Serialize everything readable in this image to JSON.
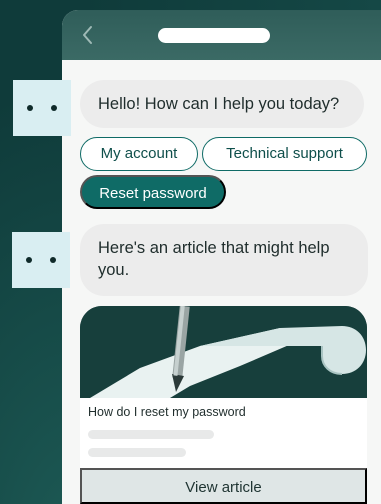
{
  "header": {
    "back_icon": "chevron-left-icon"
  },
  "messages": {
    "greeting": "Hello! How can I help you today?",
    "article_intro": "Here's an article that might help you."
  },
  "quick_replies": {
    "account": "My account",
    "technical": "Technical support",
    "reset": "Reset password"
  },
  "article": {
    "title": "How do I reset my password",
    "button": "View article",
    "image": "pen-and-paper-illustration"
  },
  "colors": {
    "background": "#0f3b3a",
    "accent": "#0f6b66",
    "bubble": "#ececec",
    "avatar": "#d9eef2"
  }
}
